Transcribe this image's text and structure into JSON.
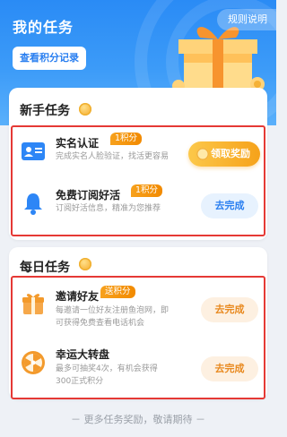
{
  "header": {
    "title": "我的任务",
    "rules_label": "规则说明",
    "points_record_label": "查看积分记录"
  },
  "newbie": {
    "section_title": "新手任务",
    "tasks": [
      {
        "name": "实名认证",
        "tag": "1积分",
        "desc": "完成实名人脸验证，找活更容易",
        "action": "领取奖励",
        "icon": "id-card-icon"
      },
      {
        "name": "免费订阅好活",
        "tag": "1积分",
        "desc": "订阅好活信息，精准为您推荐",
        "action": "去完成",
        "icon": "bell-icon"
      }
    ]
  },
  "daily": {
    "section_title": "每日任务",
    "tasks": [
      {
        "name": "邀请好友",
        "tag": "送积分",
        "desc_line1": "每邀请一位好友注册鱼泡网，即",
        "desc_line2": "可获得免费查看电话机会",
        "action": "去完成",
        "icon": "gift-box-icon"
      },
      {
        "name": "幸运大转盘",
        "desc_line1": "最多可抽奖4次，有机会获得",
        "desc_line2": "300正式积分",
        "action": "去完成",
        "icon": "lucky-wheel-icon"
      }
    ]
  },
  "footer": {
    "text": "－ 更多任务奖励，敬请期待 －"
  },
  "colors": {
    "header_blue": "#2a8bf5",
    "accent_orange": "#f6a21a",
    "highlight_red": "#e53935",
    "link_blue": "#2a7ff0"
  }
}
